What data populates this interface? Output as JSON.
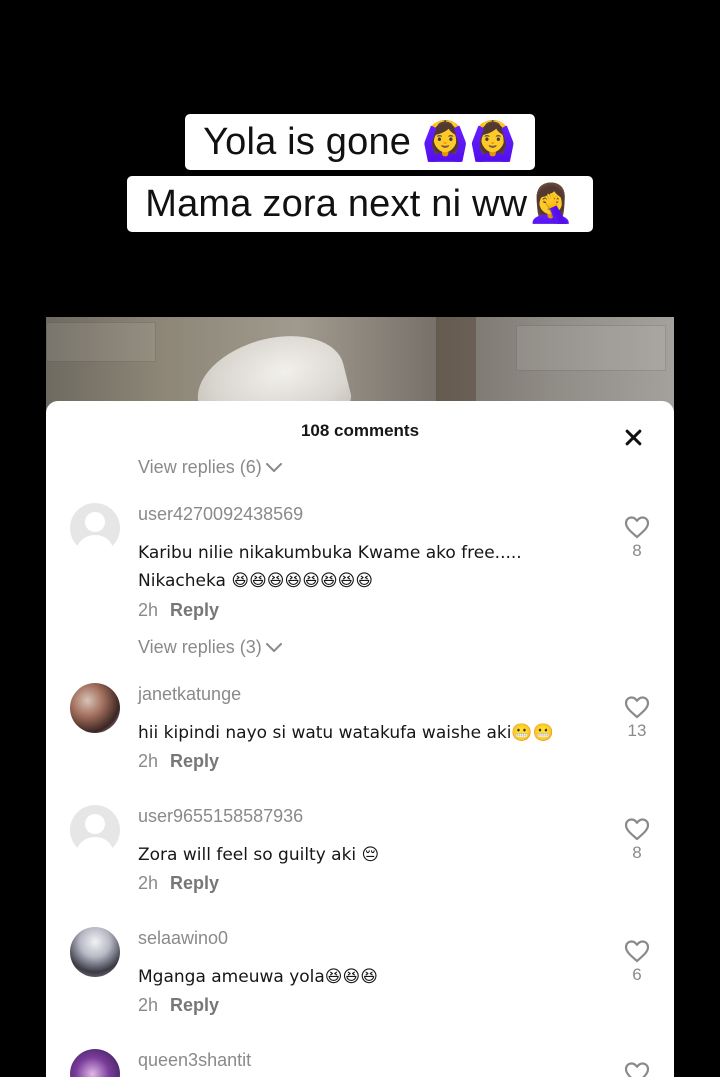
{
  "caption": {
    "line1": "Yola is gone 🙆‍♀️🙆‍♀️",
    "line2": "Mama zora next ni ww🤦‍♀️"
  },
  "sheet": {
    "title": "108 comments",
    "close_icon": "close-icon"
  },
  "replies": [
    {
      "label": "View replies (6)"
    },
    {
      "label": "View replies (3)"
    }
  ],
  "comments": [
    {
      "username": "user4270092438569",
      "text": "Karibu nilie nikakumbuka Kwame ako free..... Nikacheka 😆😆😆😆😆😆😆😆",
      "time": "2h",
      "reply_label": "Reply",
      "likes": "8",
      "avatar": "default"
    },
    {
      "username": "janetkatunge",
      "text": "hii kipindi nayo si watu watakufa waishe aki😬😬",
      "time": "2h",
      "reply_label": "Reply",
      "likes": "13",
      "avatar": "photo"
    },
    {
      "username": "user9655158587936",
      "text": "Zora will feel so guilty aki 😔",
      "time": "2h",
      "reply_label": "Reply",
      "likes": "8",
      "avatar": "default"
    },
    {
      "username": "selaawino0",
      "text": "Mganga ameuwa yola😆😆😆",
      "time": "2h",
      "reply_label": "Reply",
      "likes": "6",
      "avatar": "photo"
    },
    {
      "username": "queen3shantit",
      "avatar": "photo"
    }
  ]
}
